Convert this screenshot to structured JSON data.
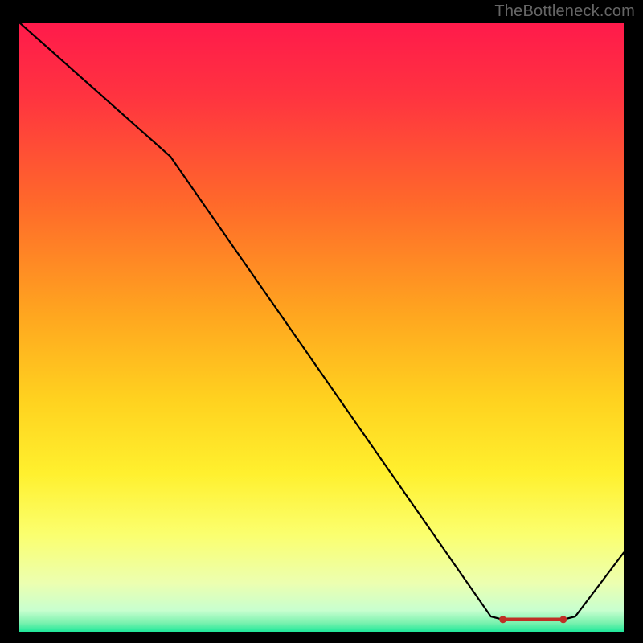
{
  "attribution": "TheBottleneck.com",
  "chart_data": {
    "type": "line",
    "title": "",
    "xlabel": "",
    "ylabel": "",
    "xlim": [
      0,
      100
    ],
    "ylim": [
      0,
      100
    ],
    "grid": false,
    "legend": false,
    "background": {
      "type": "vertical-gradient",
      "stops": [
        {
          "pos": 0.0,
          "color": "#ff1a4b"
        },
        {
          "pos": 0.12,
          "color": "#ff3340"
        },
        {
          "pos": 0.3,
          "color": "#ff6a2a"
        },
        {
          "pos": 0.48,
          "color": "#ffa61f"
        },
        {
          "pos": 0.62,
          "color": "#ffd21f"
        },
        {
          "pos": 0.74,
          "color": "#fff02e"
        },
        {
          "pos": 0.84,
          "color": "#fbff6e"
        },
        {
          "pos": 0.92,
          "color": "#ecffb0"
        },
        {
          "pos": 0.965,
          "color": "#c8ffcf"
        },
        {
          "pos": 0.985,
          "color": "#7df2b0"
        },
        {
          "pos": 1.0,
          "color": "#20e89a"
        }
      ]
    },
    "series": [
      {
        "name": "bottleneck-curve",
        "color": "#000000",
        "points": [
          {
            "x": 0,
            "y": 100
          },
          {
            "x": 25,
            "y": 78
          },
          {
            "x": 78,
            "y": 2.5
          },
          {
            "x": 80,
            "y": 2
          },
          {
            "x": 90,
            "y": 2
          },
          {
            "x": 92,
            "y": 2.5
          },
          {
            "x": 100,
            "y": 13
          }
        ]
      }
    ],
    "highlight_segment": {
      "name": "optimal-range",
      "color": "#bf3026",
      "points": [
        {
          "x": 80,
          "y": 2
        },
        {
          "x": 90,
          "y": 2
        }
      ],
      "endpoint_markers": true
    }
  }
}
